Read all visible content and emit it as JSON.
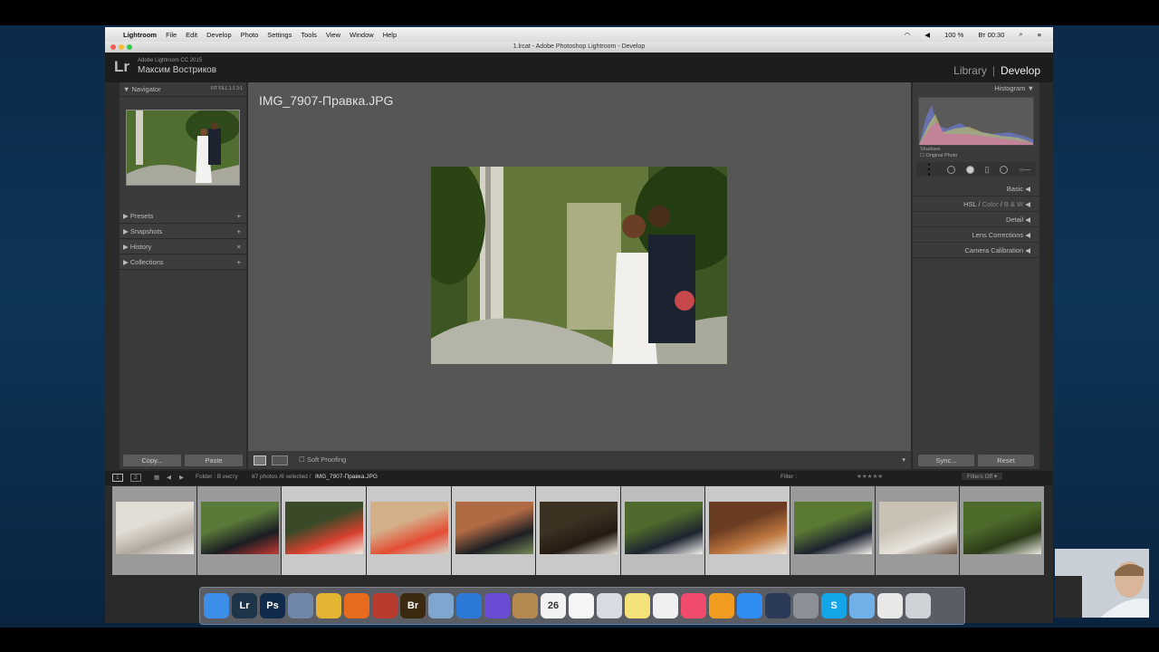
{
  "mac_menu": {
    "apple": "",
    "app_name": "Lightroom",
    "items": [
      "File",
      "Edit",
      "Develop",
      "Photo",
      "Settings",
      "Tools",
      "View",
      "Window",
      "Help"
    ],
    "battery": "100 %",
    "clock": "Вт 00:30"
  },
  "window_title": "1.lrcat - Adobe Photoshop Lightroom - Develop",
  "lr": {
    "logo": "Lr",
    "version": "Adobe Lightroom CC 2015",
    "user": "Максим Востриков",
    "module_library": "Library",
    "module_develop": "Develop"
  },
  "left_panel": {
    "navigator": "Navigator",
    "zoom": "FIT  FILL  1:1  3:1",
    "sections": [
      {
        "label": "Presets",
        "action": "+"
      },
      {
        "label": "Snapshots",
        "action": "+"
      },
      {
        "label": "History",
        "action": "×"
      },
      {
        "label": "Collections",
        "action": "+"
      }
    ],
    "copy": "Copy...",
    "paste": "Paste"
  },
  "center": {
    "filename": "IMG_7907-Правка.JPG",
    "soft_proofing": "Soft Proofing"
  },
  "right_panel": {
    "histogram": "Histogram",
    "shadows": "Shadows",
    "original_photo": "Original Photo",
    "sections": [
      "Basic",
      "Detail",
      "Lens Corrections",
      "Camera Calibration"
    ],
    "hsl": "HSL",
    "color": "Color",
    "bw": "B & W",
    "sync": "Sync...",
    "reset": "Reset"
  },
  "filmstrip_bar": {
    "page1": "1",
    "page2": "2",
    "folder": "Folder : В инсту",
    "count": "87 photos /6 selected /",
    "current": "IMG_7907-Правка.JPG",
    "filter_label": "Filter :",
    "filters_off": "Filters Off"
  },
  "filmstrip": [
    {
      "state": "normal",
      "scene": "bride-room"
    },
    {
      "state": "normal",
      "scene": "groomsmen"
    },
    {
      "state": "selected",
      "scene": "bridesmaids-red"
    },
    {
      "state": "selected",
      "scene": "bridesmaids-street"
    },
    {
      "state": "selected",
      "scene": "groomsmen-street"
    },
    {
      "state": "selected",
      "scene": "couple-dark"
    },
    {
      "state": "light",
      "scene": "couple-bridge"
    },
    {
      "state": "selected",
      "scene": "couple-window"
    },
    {
      "state": "normal",
      "scene": "couple-park"
    },
    {
      "state": "normal",
      "scene": "bride-closeup"
    },
    {
      "state": "normal",
      "scene": "couple-forest"
    }
  ],
  "dock": [
    {
      "icon": "finder-icon",
      "color": "#3d8ee8",
      "label": ""
    },
    {
      "icon": "lightroom-icon",
      "color": "#1e3448",
      "label": "Lr"
    },
    {
      "icon": "photoshop-icon",
      "color": "#0f2a4a",
      "label": "Ps"
    },
    {
      "icon": "system-icon",
      "color": "#6f86a9",
      "label": ""
    },
    {
      "icon": "chrome-icon",
      "color": "#e2b431",
      "label": ""
    },
    {
      "icon": "firefox-icon",
      "color": "#e76a1d",
      "label": ""
    },
    {
      "icon": "photo-booth-icon",
      "color": "#b83b2f",
      "label": ""
    },
    {
      "icon": "bridge-icon",
      "color": "#3b2a10",
      "label": "Br"
    },
    {
      "icon": "preview-icon",
      "color": "#7fa6cf",
      "label": ""
    },
    {
      "icon": "safari-icon",
      "color": "#2c79d8",
      "label": ""
    },
    {
      "icon": "imovie-icon",
      "color": "#6a4bd6",
      "label": ""
    },
    {
      "icon": "contacts-icon",
      "color": "#b48a50",
      "label": ""
    },
    {
      "icon": "calendar-icon",
      "color": "#f2f2f2",
      "label": "26"
    },
    {
      "icon": "reminders-icon",
      "color": "#f5f5f5",
      "label": ""
    },
    {
      "icon": "preview2-icon",
      "color": "#d8dce2",
      "label": ""
    },
    {
      "icon": "notes-icon",
      "color": "#f5e17a",
      "label": ""
    },
    {
      "icon": "photos-icon",
      "color": "#f0f0f0",
      "label": ""
    },
    {
      "icon": "itunes-icon",
      "color": "#f04a6c",
      "label": ""
    },
    {
      "icon": "ibooks-icon",
      "color": "#f29b21",
      "label": ""
    },
    {
      "icon": "appstore-icon",
      "color": "#2f8cf0",
      "label": ""
    },
    {
      "icon": "imovie2-icon",
      "color": "#2b3a59",
      "label": ""
    },
    {
      "icon": "settings-icon",
      "color": "#8b8f96",
      "label": ""
    },
    {
      "icon": "skype-icon",
      "color": "#13a5e8",
      "label": "S"
    },
    {
      "icon": "folder-icon",
      "color": "#6fb0e8",
      "label": ""
    },
    {
      "icon": "document-icon",
      "color": "#e8e8e8",
      "label": ""
    },
    {
      "icon": "trash-icon",
      "color": "#cfd3d8",
      "label": ""
    }
  ]
}
